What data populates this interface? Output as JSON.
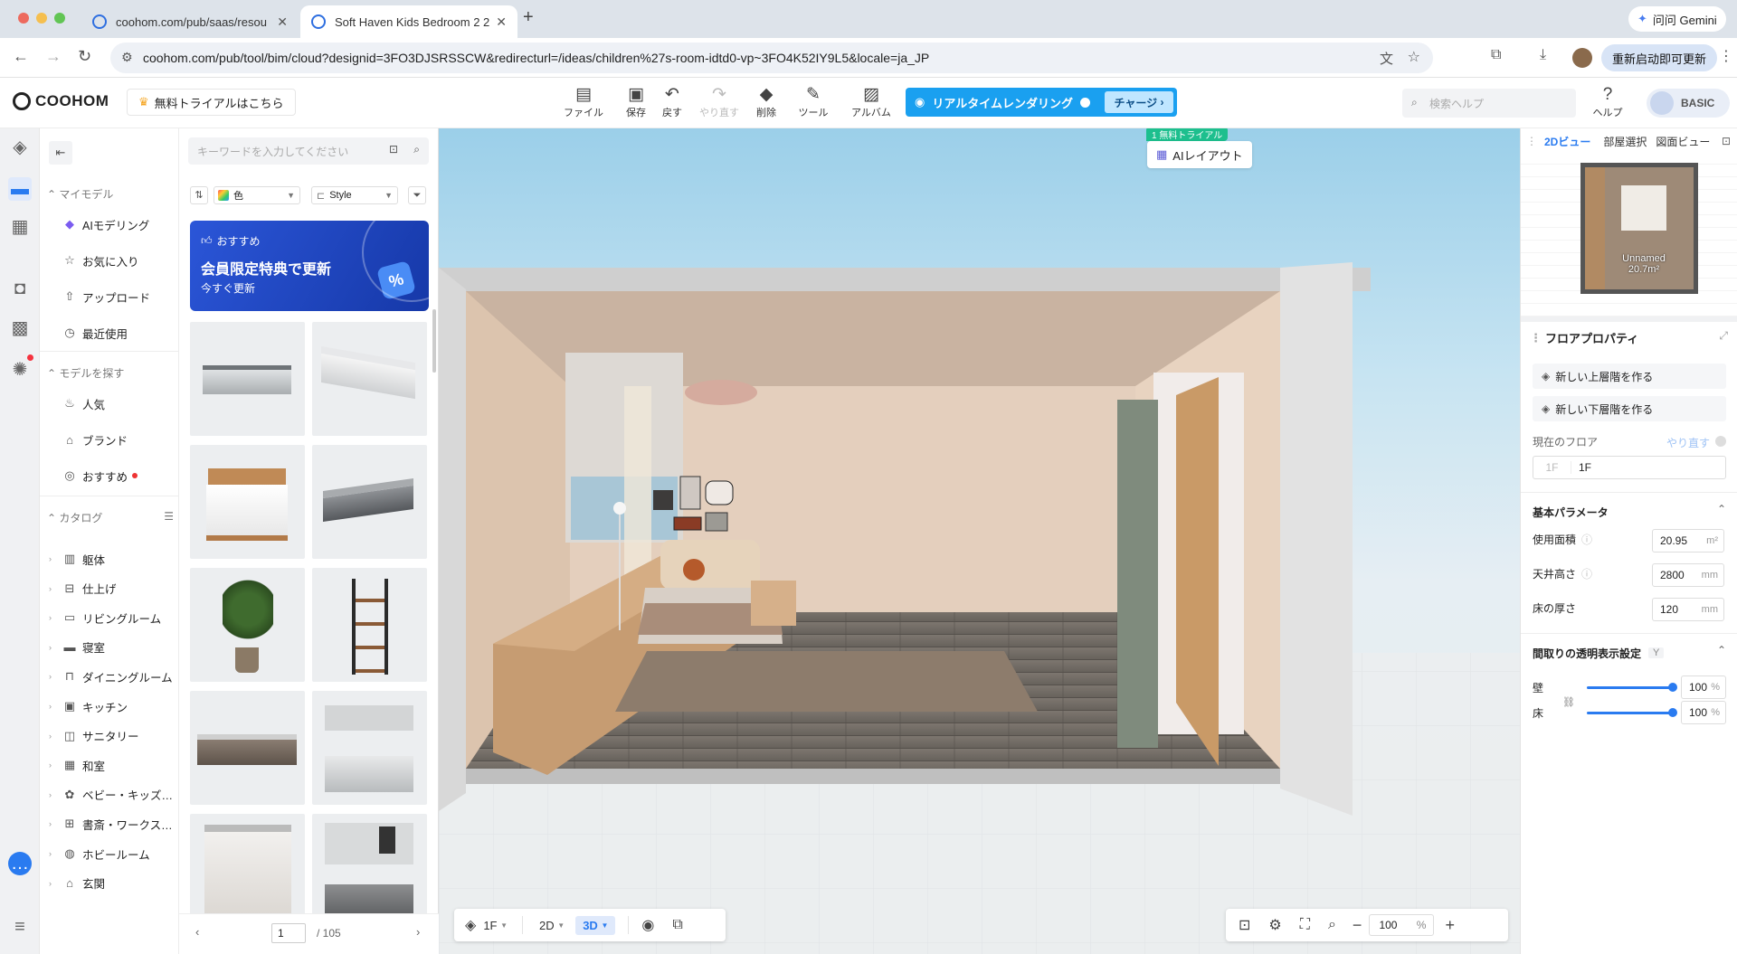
{
  "browser": {
    "tabs": [
      {
        "title": "coohom.com/pub/saas/resou",
        "active": false
      },
      {
        "title": "Soft Haven Kids Bedroom 2 2",
        "active": true
      }
    ],
    "url": "coohom.com/pub/tool/bim/cloud?designid=3FO3DJSRSSCW&redirecturl=/ideas/children%27s-room-idtd0-vp~3FO4K52IY9L5&locale=ja_JP",
    "gemini_label": "问问 Gemini",
    "update_label": "重新启动即可更新"
  },
  "app": {
    "logo": "COOHOM",
    "trial_label": "無料トライアルはこちら",
    "toolbar": [
      {
        "label": "ファイル",
        "icon": "file-icon",
        "enabled": true
      },
      {
        "label": "保存",
        "icon": "save-icon",
        "enabled": true
      },
      {
        "label": "戻す",
        "icon": "undo-icon",
        "enabled": true
      },
      {
        "label": "やり直す",
        "icon": "redo-icon",
        "enabled": false
      },
      {
        "label": "削除",
        "icon": "eraser-icon",
        "enabled": true
      },
      {
        "label": "ツール",
        "icon": "wrench-icon",
        "enabled": true
      },
      {
        "label": "アルバム",
        "icon": "album-icon",
        "enabled": true
      }
    ],
    "render_label": "リアルタイムレンダリング",
    "charge_label": "チャージ",
    "search_help_placeholder": "検索ヘルプ",
    "help_label": "ヘルプ",
    "plan_label": "BASIC"
  },
  "catalog": {
    "search_placeholder": "キーワードを入力してください",
    "my_models_header": "マイモデル",
    "my_models": [
      "AIモデリング",
      "お気に入り",
      "アップロード",
      "最近使用"
    ],
    "find_header": "モデルを探す",
    "find_items": [
      "人気",
      "ブランド",
      "おすすめ"
    ],
    "catalog_header": "カタログ",
    "catalog_items": [
      "躯体",
      "仕上げ",
      "リビングルーム",
      "寝室",
      "ダイニングルーム",
      "キッチン",
      "サニタリー",
      "和室",
      "ベビー・キッズ…",
      "書斎・ワークス…",
      "ホビールーム",
      "玄関"
    ]
  },
  "models": {
    "filter_color": "色",
    "filter_style": "Style",
    "promo": {
      "tag": "おすすめ",
      "title": "会員限定特典で更新",
      "subtitle": "今すぐ更新"
    },
    "page_current": "1",
    "page_total": "/ 105"
  },
  "canvas": {
    "ai_badge": "1 無料トライアル",
    "ai_layout_label": "AIレイアウト",
    "floor_label": "1F",
    "view_2d": "2D",
    "view_3d": "3D",
    "zoom_value": "100",
    "zoom_unit": "%"
  },
  "right_panel": {
    "tabs": [
      "2Dビュー",
      "部屋選択",
      "図面ビュー"
    ],
    "minimap_room_name": "Unnamed",
    "minimap_room_area": "20.7m²",
    "section_title": "フロアプロパティ",
    "new_upper_floor": "新しい上層階を作る",
    "new_lower_floor": "新しい下層階を作る",
    "current_floor_label": "現在のフロア",
    "redo_label": "やり直す",
    "floor_prefix": "1F",
    "floor_name": "1F",
    "basic_params_title": "基本パラメータ",
    "area_label": "使用面積",
    "area_value": "20.95",
    "area_unit": "m²",
    "ceiling_label": "天井高さ",
    "ceiling_value": "2800",
    "ceiling_unit": "mm",
    "floor_thickness_label": "床の厚さ",
    "floor_thickness_value": "120",
    "floor_thickness_unit": "mm",
    "transparency_title": "間取りの透明表示設定",
    "transparency_key": "Y",
    "wall_label": "壁",
    "wall_value": "100",
    "floor_t_label": "床",
    "floor_t_value": "100",
    "pct": "%"
  }
}
